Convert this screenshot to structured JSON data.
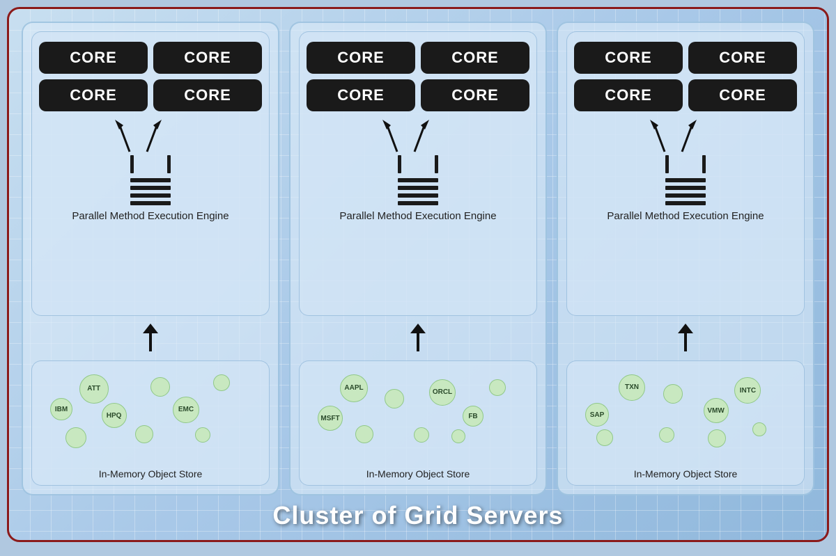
{
  "title": "Cluster of Grid Servers",
  "servers": [
    {
      "id": "server1",
      "engine_label": "Parallel Method\nExecution Engine",
      "store_label": "In-Memory Object Store",
      "cores": [
        "CORE",
        "CORE",
        "CORE",
        "CORE"
      ],
      "bubbles": [
        {
          "id": "s1-b1",
          "label": "ATT"
        },
        {
          "id": "s1-b2",
          "label": "IBM"
        },
        {
          "id": "s1-b3",
          "label": "HPQ"
        },
        {
          "id": "s1-b4",
          "label": ""
        },
        {
          "id": "s1-b5",
          "label": "EMC"
        },
        {
          "id": "s1-b6",
          "label": ""
        },
        {
          "id": "s1-b7",
          "label": ""
        },
        {
          "id": "s1-b8",
          "label": ""
        },
        {
          "id": "s1-b9",
          "label": ""
        }
      ]
    },
    {
      "id": "server2",
      "engine_label": "Parallel Method\nExecution Engine",
      "store_label": "In-Memory Object Store",
      "cores": [
        "CORE",
        "CORE",
        "CORE",
        "CORE"
      ],
      "bubbles": [
        {
          "id": "s2-b1",
          "label": "AAPL"
        },
        {
          "id": "s2-b2",
          "label": "MSFT"
        },
        {
          "id": "s2-b3",
          "label": ""
        },
        {
          "id": "s2-b4",
          "label": "ORCL"
        },
        {
          "id": "s2-b5",
          "label": "FB"
        },
        {
          "id": "s2-b6",
          "label": ""
        },
        {
          "id": "s2-b7",
          "label": ""
        },
        {
          "id": "s2-b8",
          "label": ""
        },
        {
          "id": "s2-b9",
          "label": ""
        }
      ]
    },
    {
      "id": "server3",
      "engine_label": "Parallel Method\nExecution Engine",
      "store_label": "In-Memory Object Store",
      "cores": [
        "CORE",
        "CORE",
        "CORE",
        "CORE"
      ],
      "bubbles": [
        {
          "id": "s3-b1",
          "label": "TXN"
        },
        {
          "id": "s3-b2",
          "label": "SAP"
        },
        {
          "id": "s3-b3",
          "label": ""
        },
        {
          "id": "s3-b4",
          "label": "VMW"
        },
        {
          "id": "s3-b5",
          "label": "INTC"
        },
        {
          "id": "s3-b6",
          "label": ""
        },
        {
          "id": "s3-b7",
          "label": ""
        },
        {
          "id": "s3-b8",
          "label": ""
        },
        {
          "id": "s3-b9",
          "label": ""
        }
      ]
    }
  ]
}
